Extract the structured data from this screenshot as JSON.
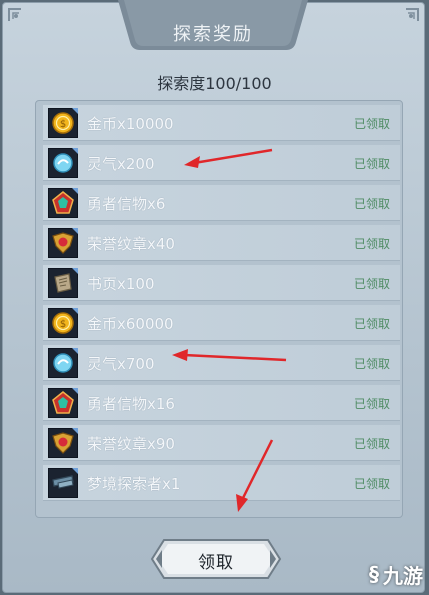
{
  "title": "探索奖励",
  "progress_label": "探索度100/100",
  "rewards": [
    {
      "name": "金币x10000",
      "status": "已领取",
      "icon": "gold-coin-icon"
    },
    {
      "name": "灵气x200",
      "status": "已领取",
      "icon": "spirit-orb-icon"
    },
    {
      "name": "勇者信物x6",
      "status": "已领取",
      "icon": "hero-token-icon"
    },
    {
      "name": "荣誉纹章x40",
      "status": "已领取",
      "icon": "honor-crest-icon"
    },
    {
      "name": "书页x100",
      "status": "已领取",
      "icon": "book-page-icon"
    },
    {
      "name": "金币x60000",
      "status": "已领取",
      "icon": "gold-coin-icon"
    },
    {
      "name": "灵气x700",
      "status": "已领取",
      "icon": "spirit-orb-icon"
    },
    {
      "name": "勇者信物x16",
      "status": "已领取",
      "icon": "hero-token-icon"
    },
    {
      "name": "荣誉纹章x90",
      "status": "已领取",
      "icon": "honor-crest-icon"
    },
    {
      "name": "梦境探索者x1",
      "status": "已领取",
      "icon": "dream-explorer-icon"
    }
  ],
  "claim_button": "领取",
  "watermark": {
    "logo_glyph": "§",
    "text": "九游"
  },
  "colors": {
    "status": "#4f8c64",
    "arrow": "#e0272a"
  }
}
